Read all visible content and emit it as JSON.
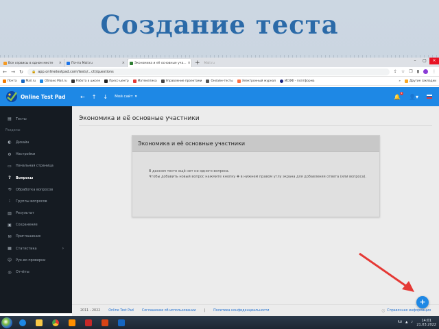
{
  "slide": {
    "title": "Создание теста"
  },
  "browser": {
    "tabs": [
      {
        "label": "Все сервисы в одном месте",
        "active": false
      },
      {
        "label": "Почта Mail.ru",
        "active": false
      },
      {
        "label": "Экономика и её основные уча...",
        "active": true
      }
    ],
    "ghost_tab": "Mail.ru",
    "url": "app.onlinetestpad.com/tests/...ctt/questions",
    "bookmarks": [
      "Почта",
      "Mail.ru",
      "Облако Mail.ru",
      "Работа в школе",
      "Пресс-центр",
      "Математика",
      "Управление проектами",
      "Онлайн-тесты",
      "Электронный журнал",
      "ИСФФ - платформа"
    ],
    "bookmarks_right": [
      "Другие закладки"
    ]
  },
  "app": {
    "brand": "Online Test Pad",
    "nav": {
      "back": "←",
      "up": "↑",
      "down": "↓",
      "my_site": "Мой сайт"
    },
    "page_title": "Экономика и её основные участники",
    "sidebar": [
      {
        "label": "Тесты",
        "icon": "list-icon",
        "type": "item"
      },
      {
        "label": "Разделы",
        "icon": "",
        "type": "section"
      },
      {
        "label": "Дизайн",
        "icon": "palette-icon",
        "type": "item"
      },
      {
        "label": "Настройки",
        "icon": "gear-icon",
        "type": "item"
      },
      {
        "label": "Начальная страница",
        "icon": "page-icon",
        "type": "item"
      },
      {
        "label": "Вопросы",
        "icon": "question-icon",
        "type": "item",
        "active": true
      },
      {
        "label": "Обработка вопросов",
        "icon": "process-icon",
        "type": "item"
      },
      {
        "label": "Группы вопросов",
        "icon": "group-icon",
        "type": "item"
      },
      {
        "label": "Результат",
        "icon": "chart-icon",
        "type": "item"
      },
      {
        "label": "Сохранение",
        "icon": "save-icon",
        "type": "item"
      },
      {
        "label": "Приглашение",
        "icon": "invite-icon",
        "type": "item"
      },
      {
        "label": "Статистика",
        "icon": "stats-icon",
        "type": "item",
        "chevron": "›"
      },
      {
        "label": "Рук-во проверки",
        "icon": "user-check-icon",
        "type": "item"
      },
      {
        "label": "Отчёты",
        "icon": "report-icon",
        "type": "item"
      }
    ],
    "card": {
      "title": "Экономика и её основные участники",
      "line1": "В данном тесте ещё нет ни одного вопроса.",
      "line2": "Чтобы добавить новый вопрос нажмите кнопку ✚ в нижнем правом углу экрана для добавления ответа (или вопроса)."
    },
    "footer": {
      "years": "2011 - 2022",
      "brand_link": "Online Test Pad",
      "agreement": "Соглашение об использовании",
      "separator": "|",
      "privacy": "Политика конфиденциальности",
      "help": "Справочная информация"
    },
    "fab_label": "+"
  },
  "taskbar": {
    "time": "14:01",
    "date": "21.03.2022",
    "lang": "RU"
  },
  "colors": {
    "accent": "#1e88e5",
    "sidebar": "#151b22",
    "title": "#2b6aa8",
    "arrow": "#e53935"
  }
}
